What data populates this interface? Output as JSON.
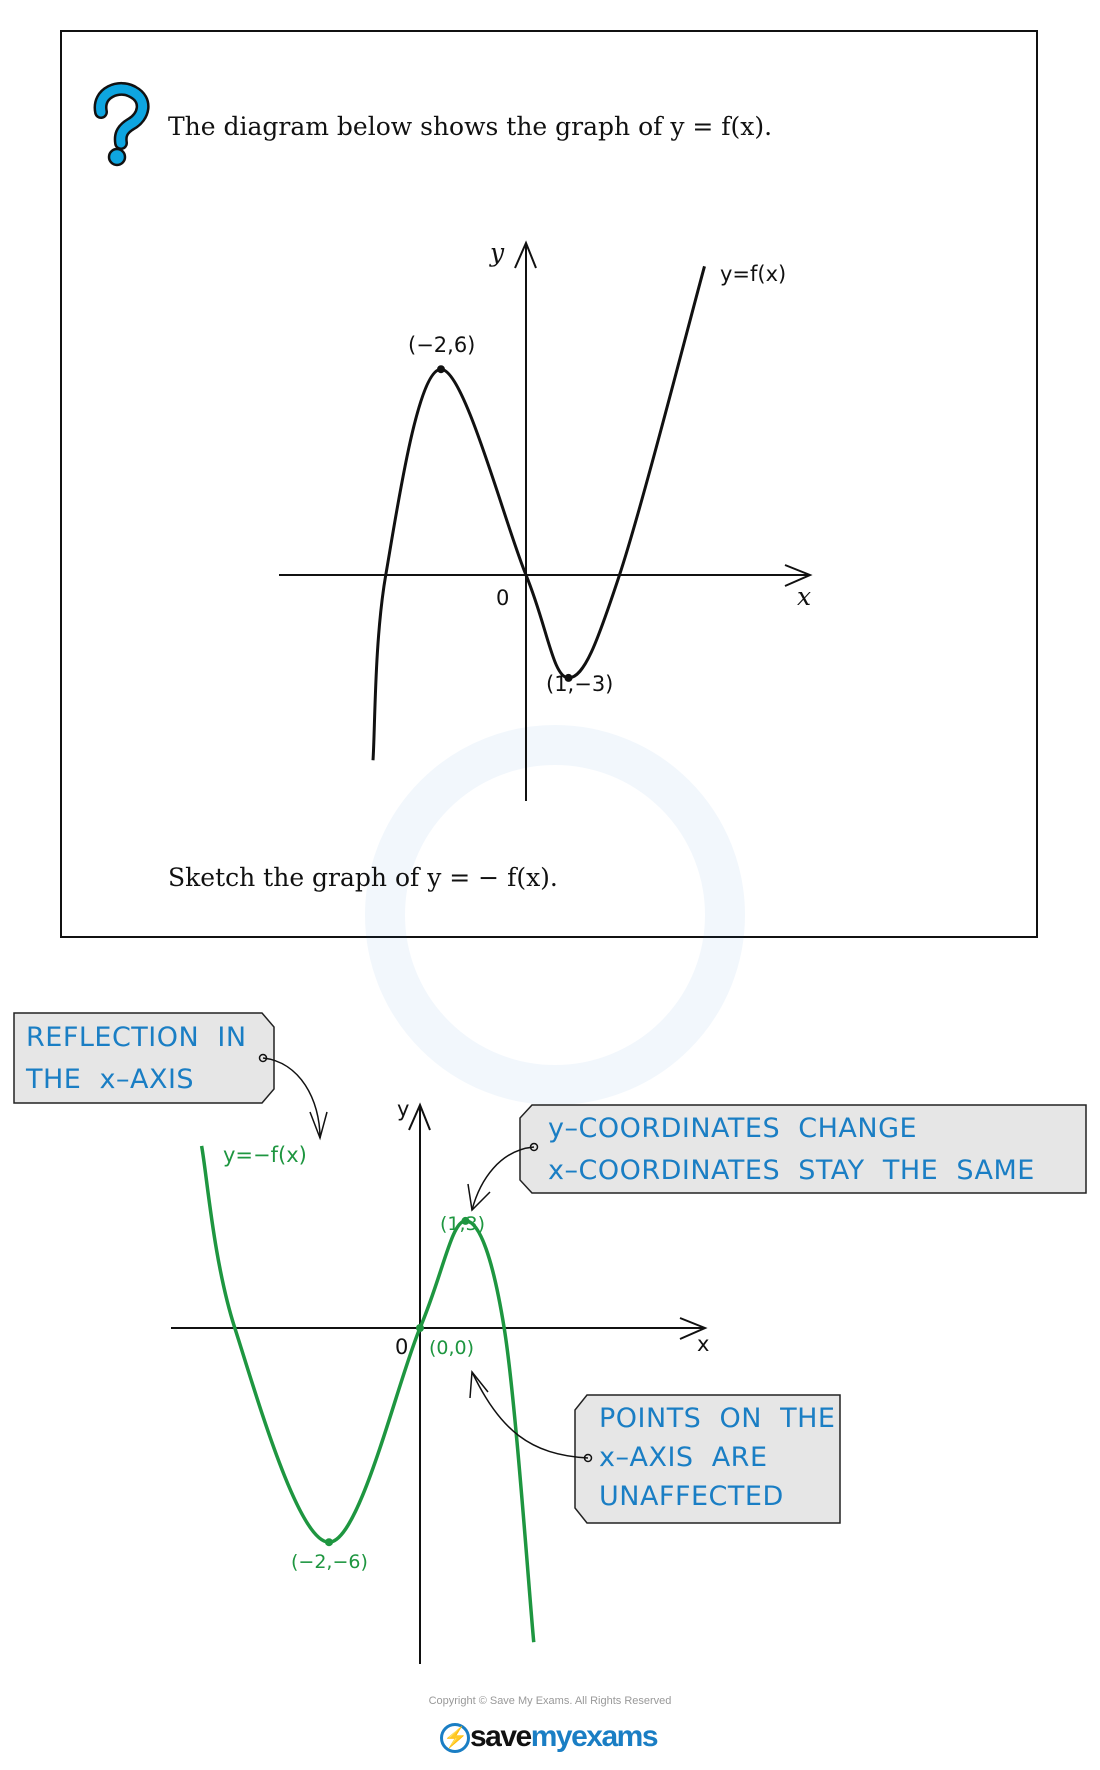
{
  "question": {
    "icon": "question-mark-icon",
    "intro": "The diagram below shows the graph of y = f(x).",
    "task": "Sketch the graph of y = − f(x)."
  },
  "chart_data": [
    {
      "type": "line",
      "curve_label": "y=f(x)",
      "xlabel": "x",
      "ylabel": "y",
      "origin_label": "0",
      "color": "#111111",
      "curve": [
        [
          -3.6,
          -5.4
        ],
        [
          -3.3,
          0
        ],
        [
          -2,
          6
        ],
        [
          0,
          0
        ],
        [
          1,
          -3
        ],
        [
          2.2,
          0
        ],
        [
          4.2,
          9
        ]
      ],
      "key_points": [
        {
          "x": -2,
          "y": 6,
          "label": "(−2,6)"
        },
        {
          "x": 1,
          "y": -3,
          "label": "(1,−3)"
        }
      ]
    },
    {
      "type": "line",
      "curve_label": "y=−f(x)",
      "xlabel": "x",
      "ylabel": "y",
      "origin_label": "0",
      "color": "#1e9640",
      "curve": [
        [
          -4.8,
          5.1
        ],
        [
          -4.07,
          0
        ],
        [
          -2,
          -6
        ],
        [
          0,
          0
        ],
        [
          1,
          3
        ],
        [
          1.85,
          0
        ],
        [
          2.5,
          -8.8
        ]
      ],
      "key_points": [
        {
          "x": 1,
          "y": 3,
          "label": "(1,3)"
        },
        {
          "x": 0,
          "y": 0,
          "label": "(0,0)"
        },
        {
          "x": -2,
          "y": -6,
          "label": "(−2,−6)"
        }
      ]
    }
  ],
  "notes": {
    "reflection": "REFLECTION  IN\nTHE  x–AXIS",
    "coordinates": "y–COORDINATES  CHANGE\nx–COORDINATES  STAY  THE  SAME",
    "points": "POINTS  ON  THE\nx–AXIS  ARE\nUNAFFECTED"
  },
  "colors": {
    "note_text": "#1a7ec4",
    "note_fill": "#e6e6e6",
    "green": "#1e9640",
    "icon_blue": "#0ea5e0"
  },
  "footer": {
    "copyright": "Copyright © Save My Exams. All Rights Reserved",
    "logo_save": "save",
    "logo_my": "my",
    "logo_exams": "exams"
  }
}
